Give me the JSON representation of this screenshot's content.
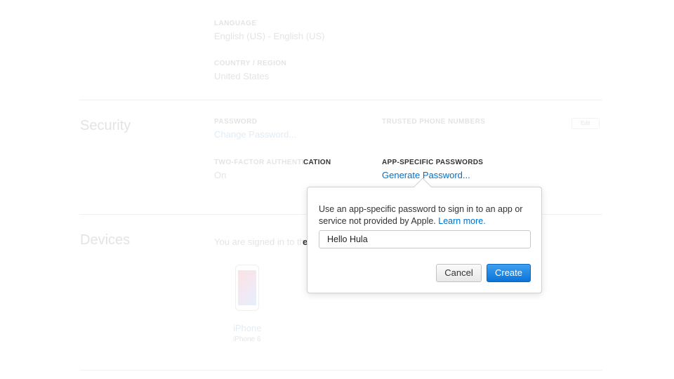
{
  "background": {
    "language": {
      "label": "LANGUAGE",
      "value": "English (US) - English (US)"
    },
    "country": {
      "label": "COUNTRY / REGION",
      "value": "United States"
    },
    "security": {
      "title": "Security",
      "password": {
        "label": "PASSWORD",
        "link": "Change Password..."
      },
      "trusted_phone": {
        "label": "TRUSTED PHONE NUMBERS",
        "edit": "Edit"
      },
      "two_factor": {
        "label_faded": "TWO-FACTOR AUTHENTI",
        "label_visible": "CATION",
        "value": "On"
      },
      "app_specific": {
        "label": "APP-SPECIFIC PASSWORDS",
        "link": "Generate Password..."
      }
    },
    "devices": {
      "title": "Devices",
      "signed_in_text_faded": "You are signed in to th",
      "signed_in_text_visible": "e",
      "device": {
        "name": "iPhone",
        "model": "iPhone 6"
      }
    }
  },
  "popover": {
    "description": "Use an app-specific password to sign in to an app or service not provided by Apple.",
    "learn_more": "Learn more.",
    "input_value": "Hello Hula",
    "cancel_label": "Cancel",
    "create_label": "Create"
  },
  "colors": {
    "link": "#0070c9",
    "primary_button": "#0a74d8"
  }
}
